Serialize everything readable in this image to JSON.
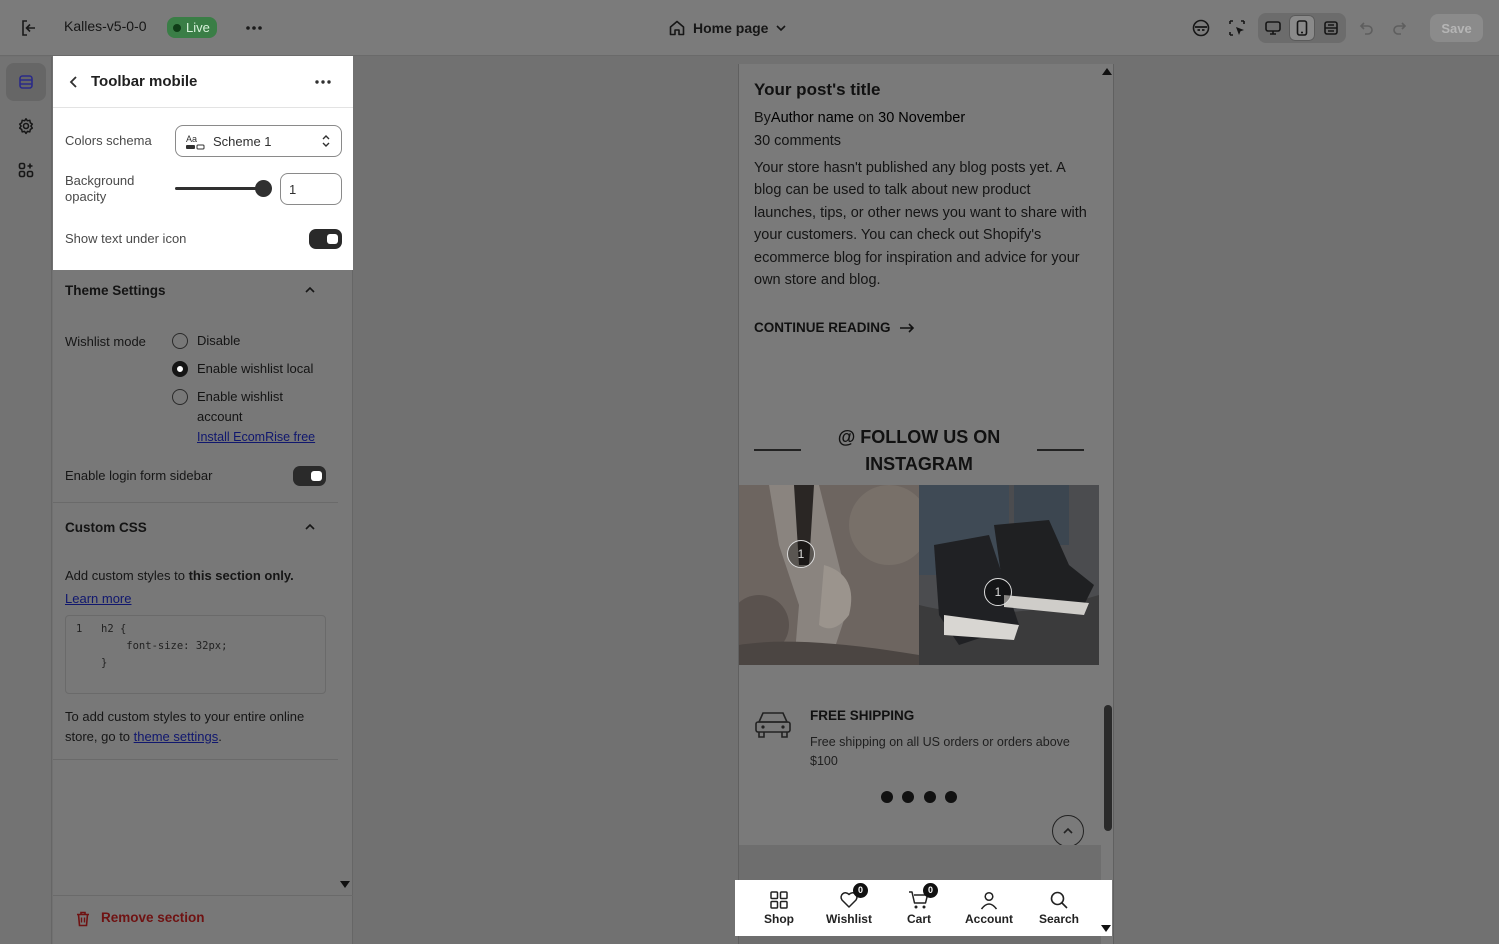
{
  "topbar": {
    "store_name": "Kalles-v5-0-0",
    "live_label": "Live",
    "page_name": "Home page",
    "save_label": "Save"
  },
  "popup": {
    "title": "Toolbar mobile",
    "colors_schema_label": "Colors schema",
    "colors_schema_value": "Scheme 1",
    "bg_opacity_label": "Background opacity",
    "bg_opacity_value": "1",
    "bg_opacity_level": 1,
    "show_text_label": "Show text under icon",
    "show_text_enabled": true
  },
  "theme_settings": {
    "title": "Theme Settings",
    "wishlist_label": "Wishlist mode",
    "options": [
      {
        "label": "Disable",
        "selected": false
      },
      {
        "label": "Enable wishlist local",
        "selected": true
      },
      {
        "label": "Enable wishlist account",
        "selected": false
      }
    ],
    "install_link": "Install EcomRise free",
    "login_sidebar_label": "Enable login form sidebar",
    "login_sidebar_enabled": true
  },
  "custom_css": {
    "title": "Custom CSS",
    "desc_prefix": "Add custom styles to ",
    "desc_bold": "this section only.",
    "learn_more": "Learn more",
    "code_line_no": "1",
    "code_lines": [
      "h2 {",
      "    font-size: 32px;",
      "}"
    ],
    "footer_prefix": "To add custom styles to your entire online store, go to ",
    "footer_link": "theme settings",
    "footer_suffix": "."
  },
  "remove_section": "Remove section",
  "preview": {
    "post_title": "Your post's title",
    "post_by": "By",
    "post_author": "Author name",
    "post_on": " on ",
    "post_date": "30 November",
    "post_comments": "30 comments",
    "post_body": "Your store hasn't published any blog posts yet. A blog can be used to talk about new product launches, tips, or other news you want to share with your customers. You can check out Shopify's ecommerce blog for inspiration and advice for your own store and blog.",
    "continue_reading": "CONTINUE READING",
    "follow_title": "@ FOLLOW US ON INSTAGRAM",
    "insta_badges": [
      "1",
      "1"
    ],
    "shipping_title": "FREE SHIPPING",
    "shipping_desc": "Free shipping on all US orders or orders above $100"
  },
  "mobile_toolbar": [
    {
      "label": "Shop",
      "icon": "grid-icon"
    },
    {
      "label": "Wishlist",
      "icon": "heart-icon",
      "badge": "0"
    },
    {
      "label": "Cart",
      "icon": "cart-icon",
      "badge": "0"
    },
    {
      "label": "Account",
      "icon": "user-icon"
    },
    {
      "label": "Search",
      "icon": "search-icon"
    }
  ],
  "colors": {
    "live_badge": "#3a7e46",
    "remove_text": "#6f1212",
    "link": "#10176e"
  }
}
